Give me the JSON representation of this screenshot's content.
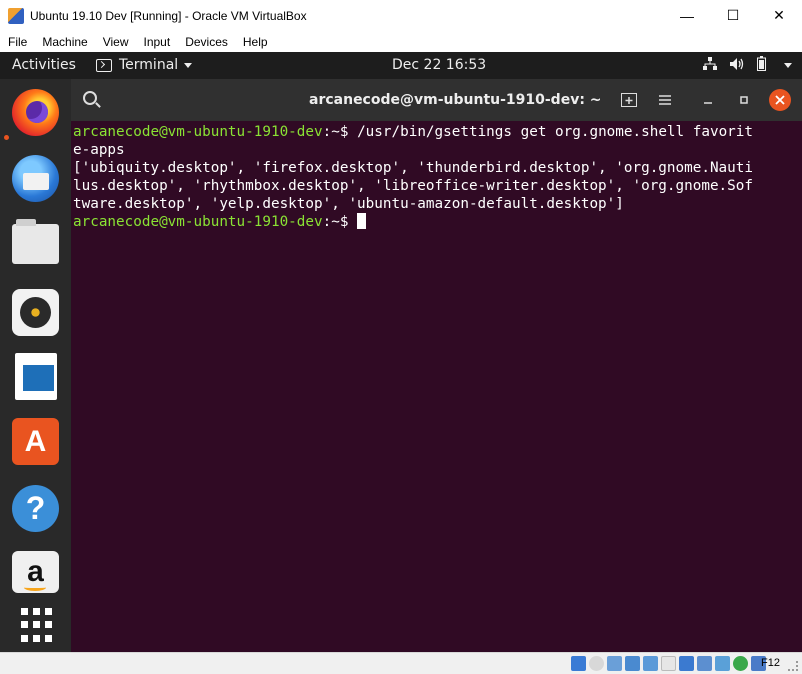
{
  "host_window": {
    "title": "Ubuntu 19.10 Dev [Running] - Oracle VM VirtualBox",
    "controls": {
      "minimize": "—",
      "maximize": "☐",
      "close": "✕"
    },
    "menu": [
      "File",
      "Machine",
      "View",
      "Input",
      "Devices",
      "Help"
    ]
  },
  "gnome_topbar": {
    "activities": "Activities",
    "app_menu": "Terminal",
    "clock": "Dec 22  16:53"
  },
  "dock": {
    "apps": [
      {
        "name": "firefox",
        "running": true
      },
      {
        "name": "thunderbird"
      },
      {
        "name": "files"
      },
      {
        "name": "rhythmbox"
      },
      {
        "name": "libreoffice-writer"
      },
      {
        "name": "ubuntu-software",
        "glyph": "A"
      },
      {
        "name": "help",
        "glyph": "?"
      },
      {
        "name": "amazon",
        "glyph": "a"
      },
      {
        "name": "show-applications"
      }
    ]
  },
  "terminal": {
    "title": "arcanecode@vm-ubuntu-1910-dev: ~",
    "lines": [
      {
        "prompt": "arcanecode@vm-ubuntu-1910-dev",
        "sep": ":~$ ",
        "command": "/usr/bin/gsettings get org.gnome.shell favorit"
      },
      {
        "text": "e-apps"
      },
      {
        "text": "['ubiquity.desktop', 'firefox.desktop', 'thunderbird.desktop', 'org.gnome.Nauti"
      },
      {
        "text": "lus.desktop', 'rhythmbox.desktop', 'libreoffice-writer.desktop', 'org.gnome.Sof"
      },
      {
        "text": "tware.desktop', 'yelp.desktop', 'ubuntu-amazon-default.desktop']"
      },
      {
        "prompt": "arcanecode@vm-ubuntu-1910-dev",
        "sep": ":~$ ",
        "command": ""
      }
    ]
  },
  "statusbar": {
    "host_key": "F12"
  },
  "colors": {
    "terminal_bg": "#300a24",
    "prompt_green": "#8ae234",
    "ubuntu_orange": "#e95420"
  }
}
